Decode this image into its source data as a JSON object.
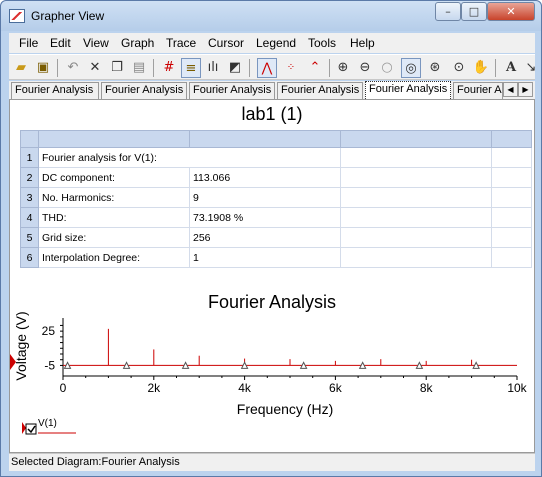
{
  "window": {
    "title": "Grapher View",
    "minimize": "–",
    "maximize": "□",
    "close": "✕"
  },
  "menu": [
    "File",
    "Edit",
    "View",
    "Graph",
    "Trace",
    "Cursor",
    "Legend",
    "Tools",
    "Help"
  ],
  "toolbar_icons": [
    "open-folder-icon",
    "save-icon",
    "undo-icon",
    "delete-icon",
    "copy-icon",
    "paste-icon",
    "grid-icon",
    "table-icon",
    "bar-chart-icon",
    "window-icon",
    "peak-icon",
    "scatter-dots-icon",
    "line-dots-icon",
    "zoom-in-icon",
    "zoom-out-icon",
    "zoom-reset-icon",
    "zoom-area-icon",
    "zoom-fit-icon",
    "zoom-select-icon",
    "pan-hand-icon",
    "text-icon",
    "arrow-icon"
  ],
  "tabs": [
    "Fourier Analysis",
    "Fourier Analysis",
    "Fourier Analysis",
    "Fourier Analysis",
    "Fourier Analysis",
    "Fourier A"
  ],
  "active_tab_index": 4,
  "page_title": "lab1 (1)",
  "table": {
    "rows": [
      {
        "num": "1",
        "label": "Fourier analysis for V(1):",
        "value": ""
      },
      {
        "num": "2",
        "label": "DC component:",
        "value": "113.066"
      },
      {
        "num": "3",
        "label": "No. Harmonics:",
        "value": "9"
      },
      {
        "num": "4",
        "label": "THD:",
        "value": "73.1908 %"
      },
      {
        "num": "5",
        "label": "Grid size:",
        "value": "256"
      },
      {
        "num": "6",
        "label": "Interpolation Degree:",
        "value": "1"
      }
    ]
  },
  "chart_data": {
    "type": "bar",
    "title": "Fourier Analysis",
    "xlabel": "Frequency (Hz)",
    "ylabel": "Voltage (V)",
    "xlim": [
      0,
      10000
    ],
    "ylim": [
      -9,
      33
    ],
    "x_ticks": [
      "0",
      "2k",
      "4k",
      "6k",
      "8k",
      "10k"
    ],
    "x_tick_values": [
      0,
      2000,
      4000,
      6000,
      8000,
      10000
    ],
    "y_ticks": [
      "25",
      "-5"
    ],
    "y_tick_values": [
      25,
      -5
    ],
    "baseline": -5,
    "series": [
      {
        "name": "V(1)",
        "color": "#cc0000",
        "x": [
          1000,
          2000,
          3000,
          4000,
          5000,
          6000,
          7000,
          8000,
          9000
        ],
        "values": [
          27,
          9,
          3.5,
          1,
          0.5,
          -1,
          0.5,
          -1,
          0
        ]
      }
    ],
    "marker_x": [
      100,
      1400,
      2700,
      4000,
      5300,
      6600,
      7850,
      9100
    ],
    "legend": "bottom-left"
  },
  "status_text": "Selected Diagram:Fourier Analysis",
  "colors": {
    "accent": "#cc0000",
    "header": "#c9d8ee"
  }
}
